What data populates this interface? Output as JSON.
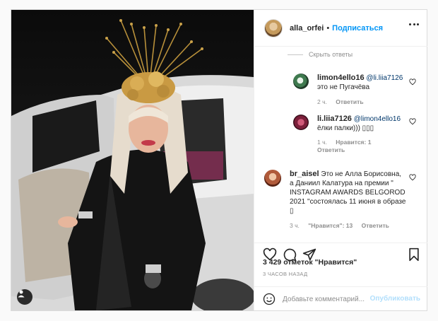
{
  "post": {
    "username": "alla_orfei",
    "separator": "•",
    "follow_label": "Подписаться",
    "more_icon": "more-options-icon"
  },
  "comments": {
    "hide_replies_label": "Скрыть ответы",
    "items": [
      {
        "username": "limon4ello16",
        "mention": "@li.liia7126",
        "text": "это не Пугачёва",
        "time": "2 ч.",
        "likes": "",
        "reply_label": "Ответить"
      },
      {
        "username": "li.liia7126",
        "mention": "@limon4ello16",
        "text": "ёлки палки))) ▯▯▯",
        "time": "1 ч.",
        "likes": "Нравится: 1",
        "reply_label": "Ответить"
      },
      {
        "username": "br_aisel",
        "mention": "",
        "text": "Это не Алла Борисовна, а Даниил Калатура на премии \" INSTAGRAM AWARDS BELGOROD 2021 \"состоялась 11 июня в образе ▯",
        "time": "3 ч.",
        "likes": "\"Нравится\": 13",
        "reply_label": "Ответить"
      }
    ]
  },
  "actions": {
    "like_icon": "heart-icon",
    "comment_icon": "comment-icon",
    "share_icon": "share-icon",
    "save_icon": "bookmark-icon"
  },
  "likes_text": "3 429 отметок \"Нравится\"",
  "timestamp": "3 ЧАСОВ НАЗАД",
  "composer": {
    "placeholder": "Добавьте комментарий...",
    "publish_label": "Опубликовать"
  },
  "colors": {
    "accent": "#0095f6",
    "publish_disabled": "#b2dffc",
    "muted": "#8e8e8e"
  }
}
